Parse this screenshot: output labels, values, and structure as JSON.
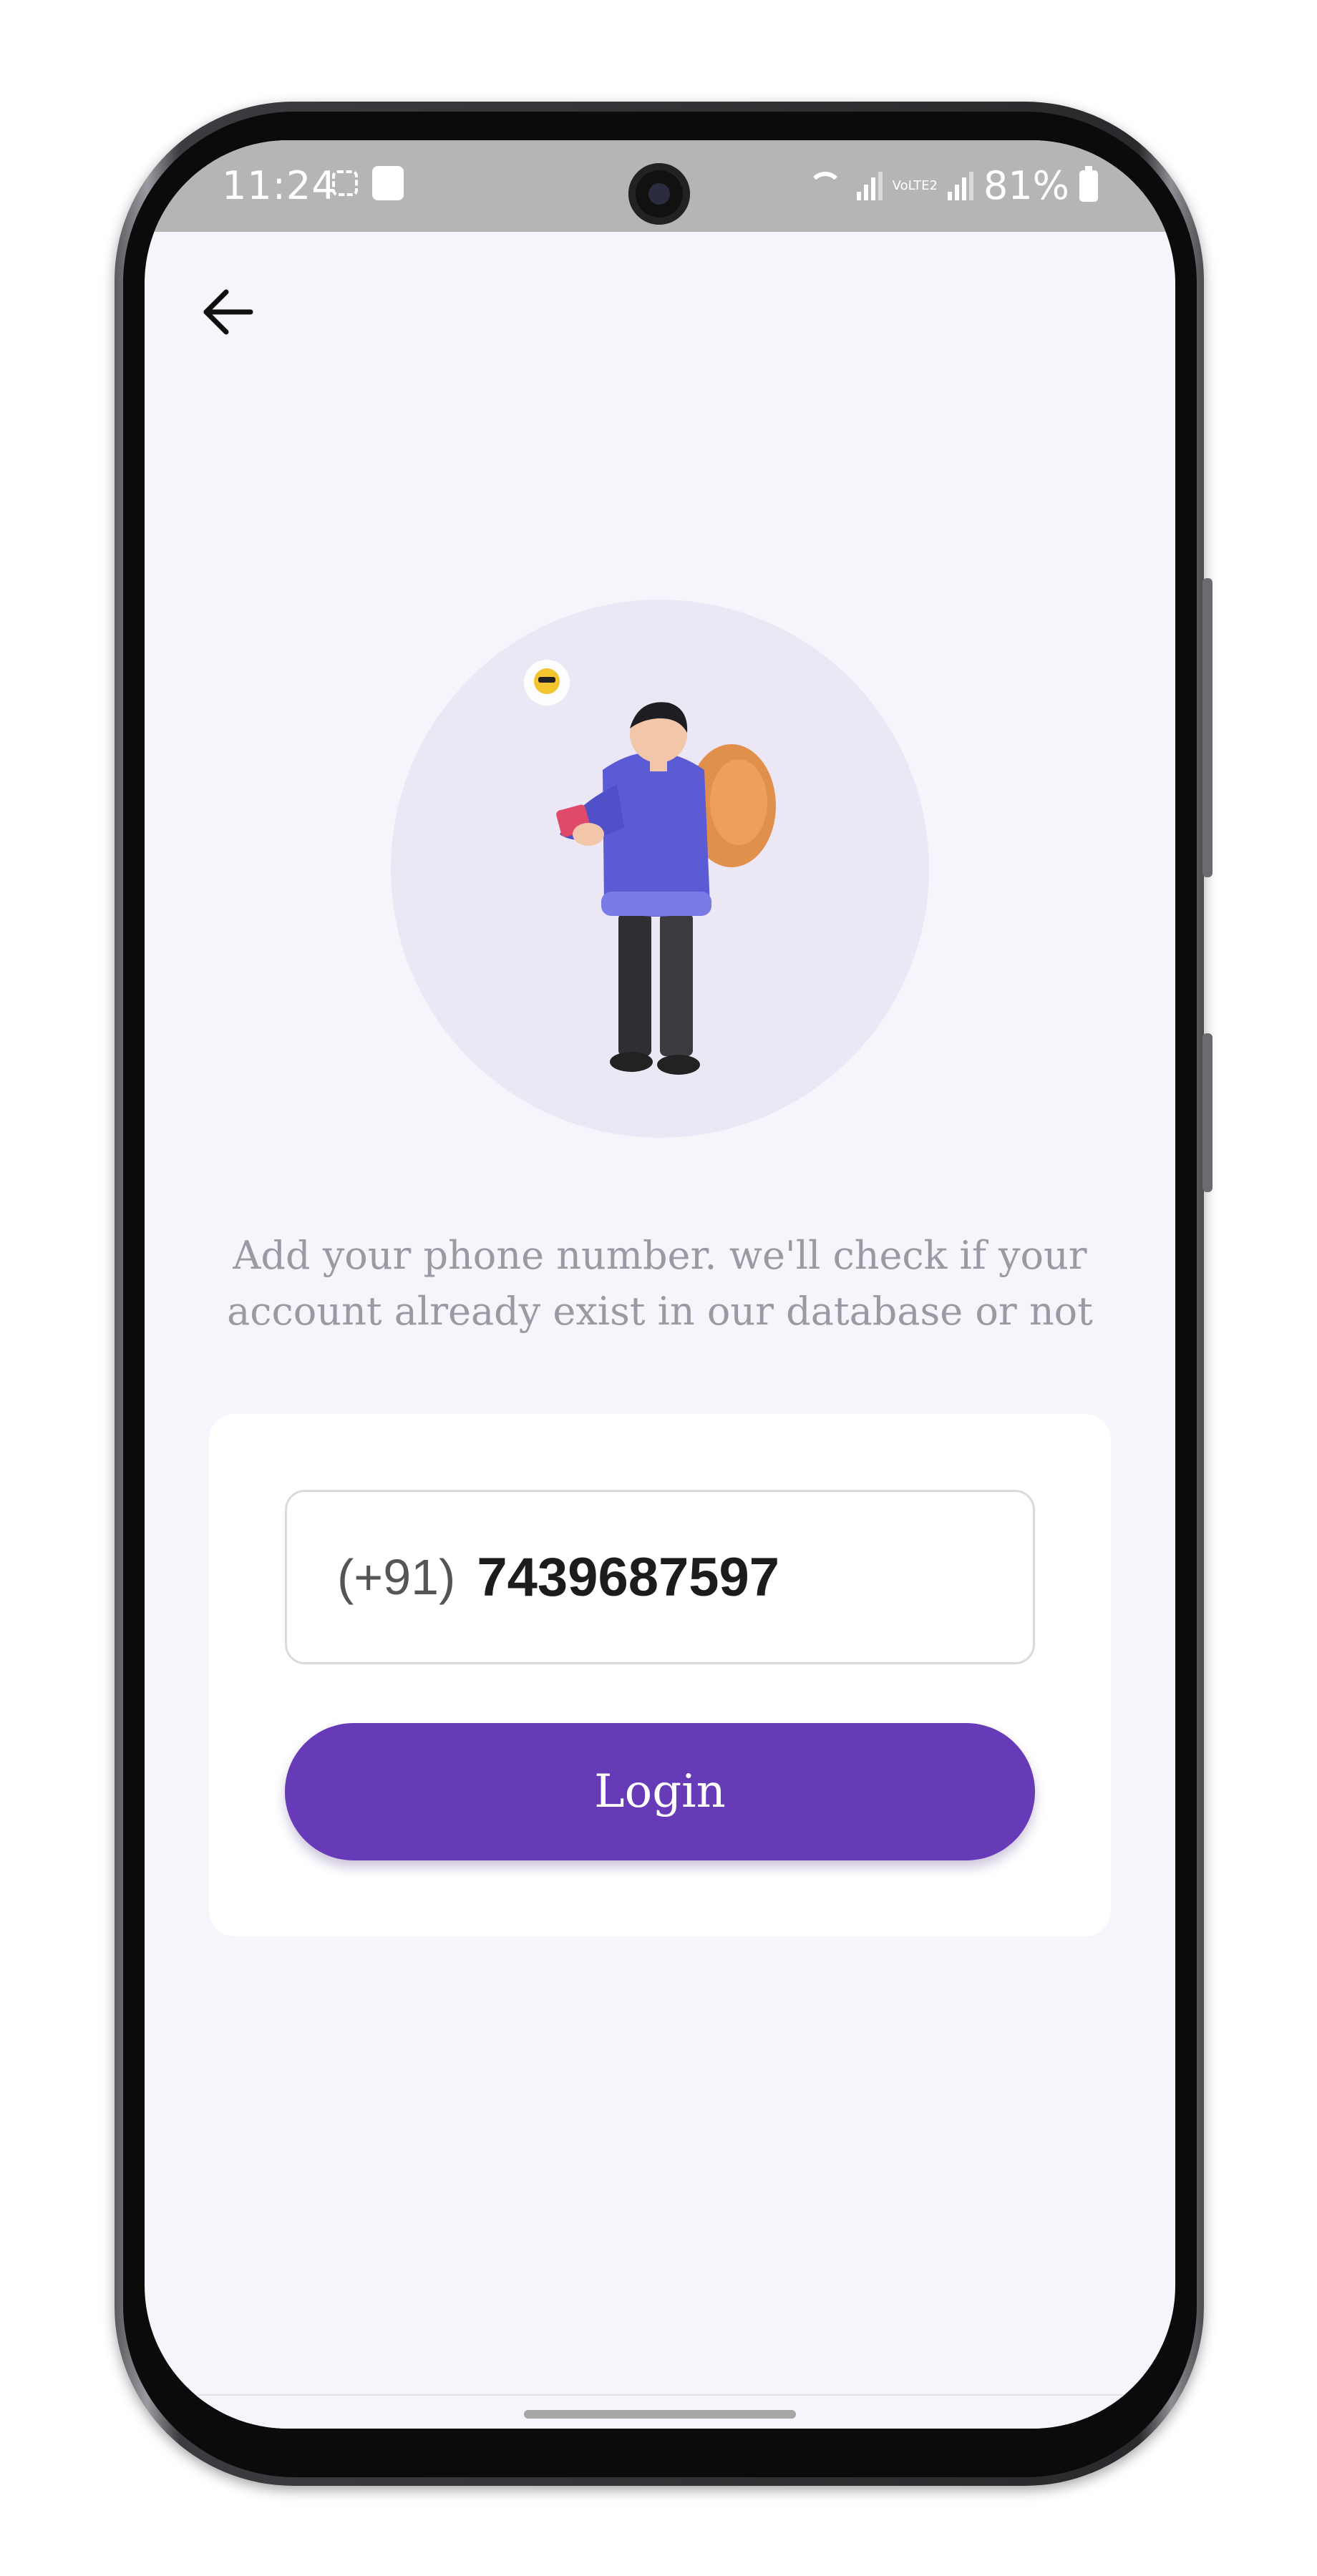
{
  "status_bar": {
    "time": "11:24",
    "battery": "81%",
    "volte_label": "VoLTE2",
    "icons": [
      "screenshot-icon",
      "notification-icon",
      "wifi-icon",
      "signal-icon",
      "volte-icon",
      "battery-icon"
    ]
  },
  "header": {
    "back_icon": "arrow-left-icon"
  },
  "hero": {
    "illustration": "person-with-phone-illustration"
  },
  "instruction_text": "Add your phone number. we'll check if your account already exist in our database or not",
  "form": {
    "country_code": "(+91)",
    "phone_number": "7439687597",
    "login_label": "Login"
  },
  "colors": {
    "accent": "#673ab7",
    "background": "#f6f5fb",
    "hero_circle": "#ebe7f5",
    "status_bar": "#b5b5b5",
    "muted_text": "#9a9aa2"
  }
}
